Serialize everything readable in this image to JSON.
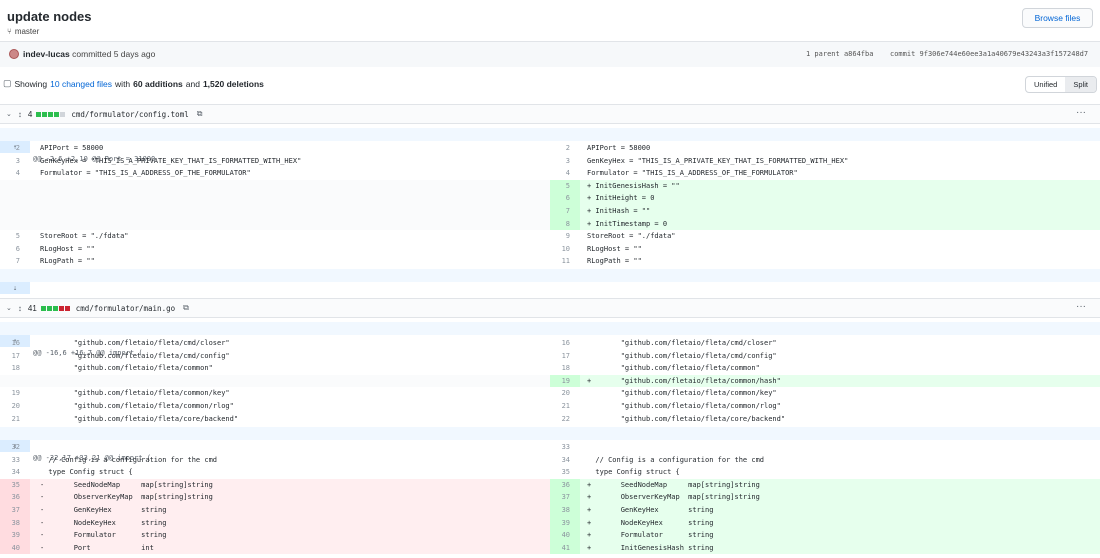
{
  "commit": {
    "title": "update nodes",
    "branch": "master",
    "author": "indev-lucas",
    "when": "committed 5 days ago",
    "parent_label": "1 parent",
    "parent_sha": "a864fba",
    "commit_label": "commit",
    "commit_sha": "9f306e744e60ee3a1a40679e43243a3f157248d7",
    "browse_label": "Browse files"
  },
  "summary": {
    "showing": "Showing",
    "changed": "10 changed files",
    "with": "with",
    "additions": "60 additions",
    "and": "and",
    "deletions": "1,520 deletions",
    "unified": "Unified",
    "split": "Split"
  },
  "files": [
    {
      "count": "4",
      "name": "cmd/formulator/config.toml",
      "hunks": [
        "@@ -2,6 +2,10 @@ Port = 31000"
      ]
    },
    {
      "count": "41",
      "name": "cmd/formulator/main.go",
      "hunks": [
        "@@ -16,6 +16,7 @@ import (",
        "@@ -32,17 +33,21 @@ import ("
      ]
    }
  ],
  "lines": {
    "f1": [
      {
        "l": "2",
        "lc": "APIPort = 58000",
        "r": "2",
        "rc": "APIPort = 58000"
      },
      {
        "l": "3",
        "lc": "GenKeyHex = \"THIS_IS_A_PRIVATE_KEY_THAT_IS_FORMATTED_WITH_HEX\"",
        "r": "3",
        "rc": "GenKeyHex = \"THIS_IS_A_PRIVATE_KEY_THAT_IS_FORMATTED_WITH_HEX\""
      },
      {
        "l": "4",
        "lc": "Formulator = \"THIS_IS_A_ADDRESS_OF_THE_FORMULATOR\"",
        "r": "4",
        "rc": "Formulator = \"THIS_IS_A_ADDRESS_OF_THE_FORMULATOR\""
      },
      {
        "l": "",
        "lc": "",
        "r": "5",
        "rc": "+ InitGenesisHash = \"\""
      },
      {
        "l": "",
        "lc": "",
        "r": "6",
        "rc": "+ InitHeight = 0"
      },
      {
        "l": "",
        "lc": "",
        "r": "7",
        "rc": "+ InitHash = \"\""
      },
      {
        "l": "",
        "lc": "",
        "r": "8",
        "rc": "+ InitTimestamp = 0"
      },
      {
        "l": "5",
        "lc": "StoreRoot = \"./fdata\"",
        "r": "9",
        "rc": "StoreRoot = \"./fdata\""
      },
      {
        "l": "6",
        "lc": "RLogHost = \"\"",
        "r": "10",
        "rc": "RLogHost = \"\""
      },
      {
        "l": "7",
        "lc": "RLogPath = \"\"",
        "r": "11",
        "rc": "RLogPath = \"\""
      }
    ],
    "f2a": [
      {
        "l": "16",
        "lc": "        \"github.com/fletaio/fleta/cmd/closer\"",
        "r": "16",
        "rc": "        \"github.com/fletaio/fleta/cmd/closer\""
      },
      {
        "l": "17",
        "lc": "        \"github.com/fletaio/fleta/cmd/config\"",
        "r": "17",
        "rc": "        \"github.com/fletaio/fleta/cmd/config\""
      },
      {
        "l": "18",
        "lc": "        \"github.com/fletaio/fleta/common\"",
        "r": "18",
        "rc": "        \"github.com/fletaio/fleta/common\""
      },
      {
        "l": "",
        "lc": "",
        "r": "19",
        "rc": "+       \"github.com/fletaio/fleta/common/hash\""
      },
      {
        "l": "19",
        "lc": "        \"github.com/fletaio/fleta/common/key\"",
        "r": "20",
        "rc": "        \"github.com/fletaio/fleta/common/key\""
      },
      {
        "l": "20",
        "lc": "        \"github.com/fletaio/fleta/common/rlog\"",
        "r": "21",
        "rc": "        \"github.com/fletaio/fleta/common/rlog\""
      },
      {
        "l": "21",
        "lc": "        \"github.com/fletaio/fleta/core/backend\"",
        "r": "22",
        "rc": "        \"github.com/fletaio/fleta/core/backend\""
      }
    ],
    "f2b": [
      {
        "l": "32",
        "lc": "",
        "r": "33",
        "rc": ""
      },
      {
        "l": "33",
        "lc": "  // Config is a configuration for the cmd",
        "r": "34",
        "rc": "  // Config is a configuration for the cmd"
      },
      {
        "l": "34",
        "lc": "  type Config struct {",
        "r": "35",
        "rc": "  type Config struct {"
      },
      {
        "l": "35",
        "lc": "-       SeedNodeMap     map[string]string",
        "r": "36",
        "rc": "+       SeedNodeMap     map[string]string"
      },
      {
        "l": "36",
        "lc": "-       ObserverKeyMap  map[string]string",
        "r": "37",
        "rc": "+       ObserverKeyMap  map[string]string"
      },
      {
        "l": "37",
        "lc": "-       GenKeyHex       string",
        "r": "38",
        "rc": "+       GenKeyHex       string"
      },
      {
        "l": "38",
        "lc": "-       NodeKeyHex      string",
        "r": "39",
        "rc": "+       NodeKeyHex      string"
      },
      {
        "l": "39",
        "lc": "-       Formulator      string",
        "r": "40",
        "rc": "+       Formulator      string"
      },
      {
        "l": "40",
        "lc": "-       Port            int",
        "r": "41",
        "rc": "+       InitGenesisHash string"
      }
    ]
  }
}
